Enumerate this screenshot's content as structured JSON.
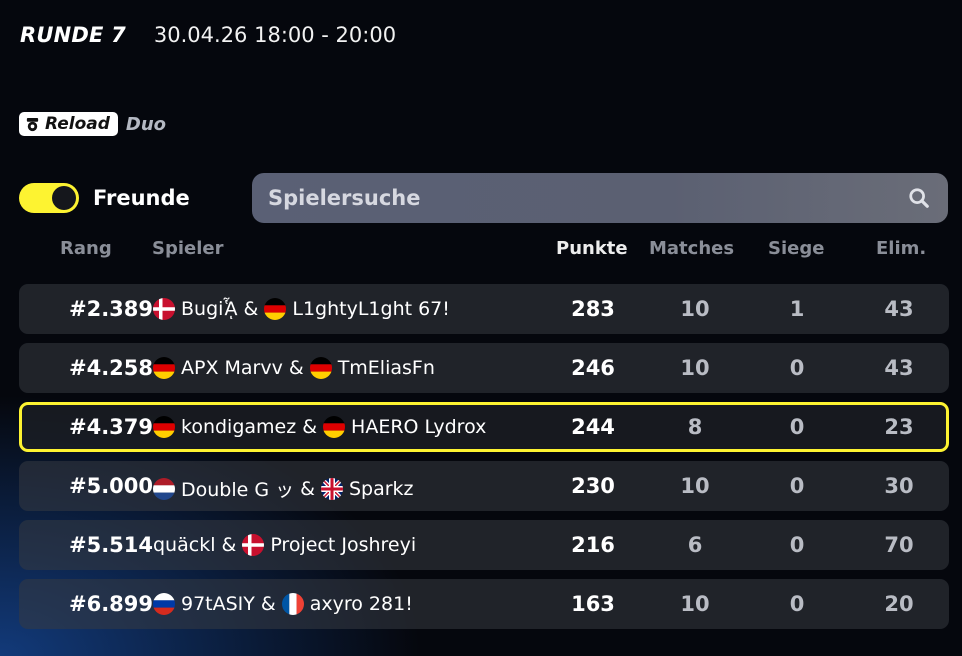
{
  "header": {
    "round": "RUNDE 7",
    "datetime": "30.04.26 18:00 - 20:00"
  },
  "mode": {
    "badge": "Reload",
    "type": "Duo"
  },
  "filters": {
    "friends_label": "Freunde",
    "friends_toggle": "on",
    "search_placeholder": "Spielersuche"
  },
  "table": {
    "columns": {
      "rank": "Rang",
      "player": "Spieler",
      "points": "Punkte",
      "matches": "Matches",
      "wins": "Siege",
      "elims": "Elim."
    },
    "rows": [
      {
        "rank": "#2.389",
        "p1": "Bugiᾏ",
        "p1_flag": "denmark-flag-icon",
        "p2": "L1ghtyL1ght 67!",
        "p2_flag": "germany-flag-icon",
        "points": "283",
        "matches": "10",
        "wins": "1",
        "elims": "43"
      },
      {
        "rank": "#4.258",
        "p1": "APX Marvv",
        "p1_flag": "germany-flag-icon",
        "p2": "TmEliasFn",
        "p2_flag": "germany-flag-icon",
        "points": "246",
        "matches": "10",
        "wins": "0",
        "elims": "43"
      },
      {
        "rank": "#4.379",
        "p1": "kondigamez",
        "p1_flag": "germany-flag-icon",
        "p2": "HAERO Lydrox",
        "p2_flag": "germany-flag-icon",
        "points": "244",
        "matches": "8",
        "wins": "0",
        "elims": "23",
        "highlighted": true
      },
      {
        "rank": "#5.000",
        "p1": "Double G ッ",
        "p1_flag": "netherlands-flag-icon",
        "p2": "Sparkz",
        "p2_flag": "uk-flag-icon",
        "points": "230",
        "matches": "10",
        "wins": "0",
        "elims": "30"
      },
      {
        "rank": "#5.514",
        "p1": "quäckl",
        "p1_flag": "",
        "p2": "Project Joshreyi",
        "p2_flag": "denmark-flag-icon",
        "points": "216",
        "matches": "6",
        "wins": "0",
        "elims": "70"
      },
      {
        "rank": "#6.899",
        "p1": "97tASIY",
        "p1_flag": "russia-flag-icon",
        "p2": "axyro 281!",
        "p2_flag": "france-flag-icon",
        "points": "163",
        "matches": "10",
        "wins": "0",
        "elims": "20"
      }
    ]
  },
  "colors": {
    "accent_yellow": "#fdf331",
    "background": "#05070d",
    "row_bg": "#2b2e35"
  }
}
